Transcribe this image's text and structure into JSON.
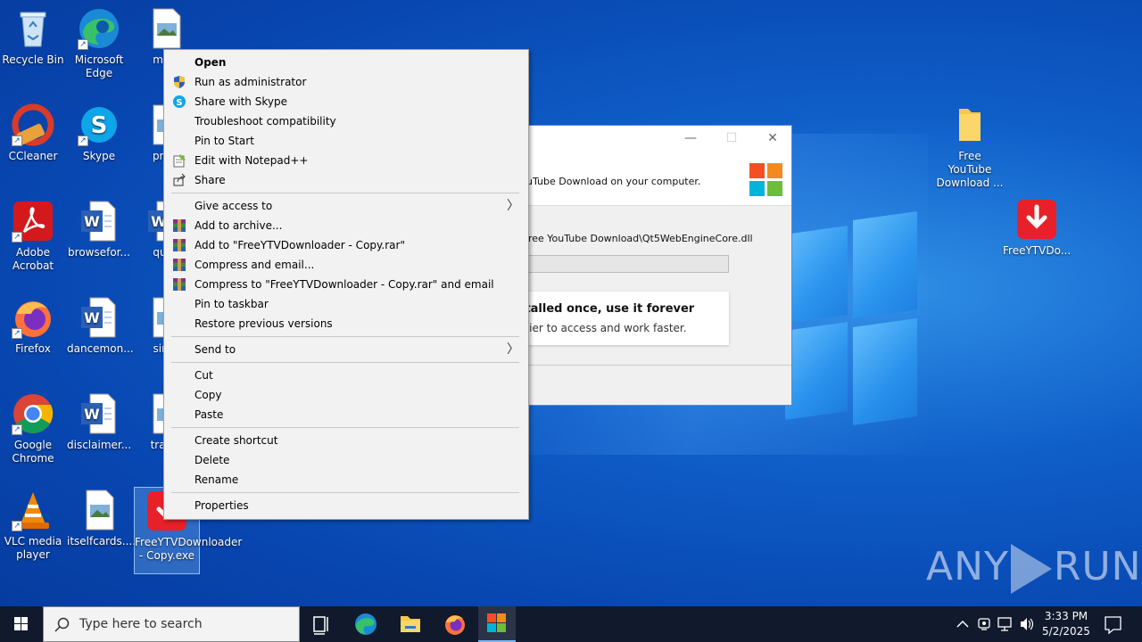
{
  "desktop": {
    "icons": [
      {
        "label": "Recycle Bin"
      },
      {
        "label": "Microsoft Edge"
      },
      {
        "label": "movi"
      },
      {
        "label": "CCleaner"
      },
      {
        "label": "Skype"
      },
      {
        "label": "previ"
      },
      {
        "label": "Adobe Acrobat"
      },
      {
        "label": "browsefor..."
      },
      {
        "label": "quali"
      },
      {
        "label": "Firefox"
      },
      {
        "label": "dancemon..."
      },
      {
        "label": "simp"
      },
      {
        "label": "Google Chrome"
      },
      {
        "label": "disclaimer..."
      },
      {
        "label": "travel"
      },
      {
        "label": "VLC media player"
      },
      {
        "label": "itselfcards...."
      },
      {
        "label": "FreeYTVDownloader - Copy.exe"
      },
      {
        "label": "Free YouTube Download ..."
      },
      {
        "label": "FreeYTVDo..."
      }
    ]
  },
  "installer": {
    "header_text": "ee YouTube Download on your computer.",
    "path_text": "Soft\\Free YouTube Download\\Qt5WebEngineCore.dll",
    "card_title": "installed once, use it forever",
    "card_subtitle": "e easier to access and work faster.",
    "minimize": "—",
    "maximize": "☐",
    "close": "✕"
  },
  "context_menu": {
    "groups": [
      [
        {
          "label": "Open",
          "bold": true,
          "icon": ""
        },
        {
          "label": "Run as administrator",
          "icon": "uac-shield-icon"
        },
        {
          "label": "Share with Skype",
          "icon": "skype-icon"
        },
        {
          "label": "Troubleshoot compatibility",
          "icon": ""
        },
        {
          "label": "Pin to Start",
          "icon": ""
        },
        {
          "label": "Edit with Notepad++",
          "icon": "notepadpp-icon"
        },
        {
          "label": "Share",
          "icon": "share-icon"
        }
      ],
      [
        {
          "label": "Give access to",
          "submenu": true,
          "icon": ""
        },
        {
          "label": "Add to archive...",
          "icon": "winrar-icon"
        },
        {
          "label": "Add to \"FreeYTVDownloader - Copy.rar\"",
          "icon": "winrar-icon"
        },
        {
          "label": "Compress and email...",
          "icon": "winrar-icon"
        },
        {
          "label": "Compress to \"FreeYTVDownloader - Copy.rar\" and email",
          "icon": "winrar-icon"
        },
        {
          "label": "Pin to taskbar",
          "icon": ""
        },
        {
          "label": "Restore previous versions",
          "icon": ""
        }
      ],
      [
        {
          "label": "Send to",
          "submenu": true,
          "icon": ""
        }
      ],
      [
        {
          "label": "Cut",
          "icon": ""
        },
        {
          "label": "Copy",
          "icon": ""
        },
        {
          "label": "Paste",
          "icon": ""
        }
      ],
      [
        {
          "label": "Create shortcut",
          "icon": ""
        },
        {
          "label": "Delete",
          "icon": ""
        },
        {
          "label": "Rename",
          "icon": ""
        }
      ],
      [
        {
          "label": "Properties",
          "icon": ""
        }
      ]
    ],
    "submenu_glyph": "〉"
  },
  "watermark": {
    "left": "ANY",
    "right": "RUN"
  },
  "taskbar": {
    "search_placeholder": "Type here to search",
    "time": "3:33 PM",
    "date": "5/2/2025"
  }
}
